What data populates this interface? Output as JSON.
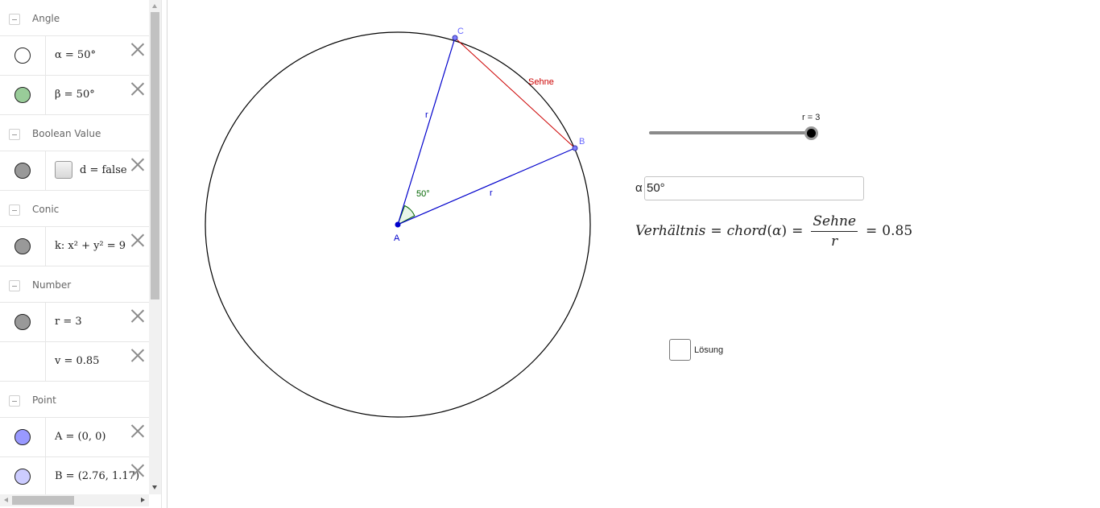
{
  "algebra": {
    "groups": [
      {
        "label": "Angle",
        "items": [
          {
            "text": "α = 50°",
            "marble_color": "#ffffff"
          },
          {
            "text": "β = 50°",
            "marble_color": "#99cc99"
          }
        ]
      },
      {
        "label": "Boolean Value",
        "items": [
          {
            "text": "d = false",
            "marble_color": "#999999"
          }
        ]
      },
      {
        "label": "Conic",
        "items": [
          {
            "text": "k: x² + y² = 9",
            "marble_color": "#999999"
          }
        ]
      },
      {
        "label": "Number",
        "items": [
          {
            "text": "r = 3",
            "marble_color": "#999999"
          },
          {
            "text": "v = 0.85"
          }
        ]
      },
      {
        "label": "Point",
        "items": [
          {
            "text": "A = (0, 0)",
            "marble_color": "#9999ff"
          },
          {
            "text": "B = (2.76, 1.17)",
            "marble_color": "#ccccff"
          }
        ]
      }
    ]
  },
  "graphics": {
    "points": {
      "A": "A",
      "B": "B",
      "C": "C"
    },
    "segment_labels": {
      "ac": "r",
      "ab": "r",
      "bc": "Sehne"
    },
    "angle_label": "50°",
    "slider": {
      "label": "r = 3",
      "value": 3
    },
    "input": {
      "label": "α",
      "value": "50°"
    },
    "formula": {
      "lhs": "Verhältnis",
      "eq1": "=",
      "func": "chord",
      "arg": "α",
      "eq2": "=",
      "num": "Sehne",
      "den": "r",
      "eq3": "=",
      "result": "0.85"
    },
    "checkbox": {
      "label": "Lösung",
      "checked": false
    },
    "colors": {
      "segments": "#0000cc",
      "chord": "#cc0000",
      "angle": "#006400",
      "point": "#4d4dff"
    }
  }
}
